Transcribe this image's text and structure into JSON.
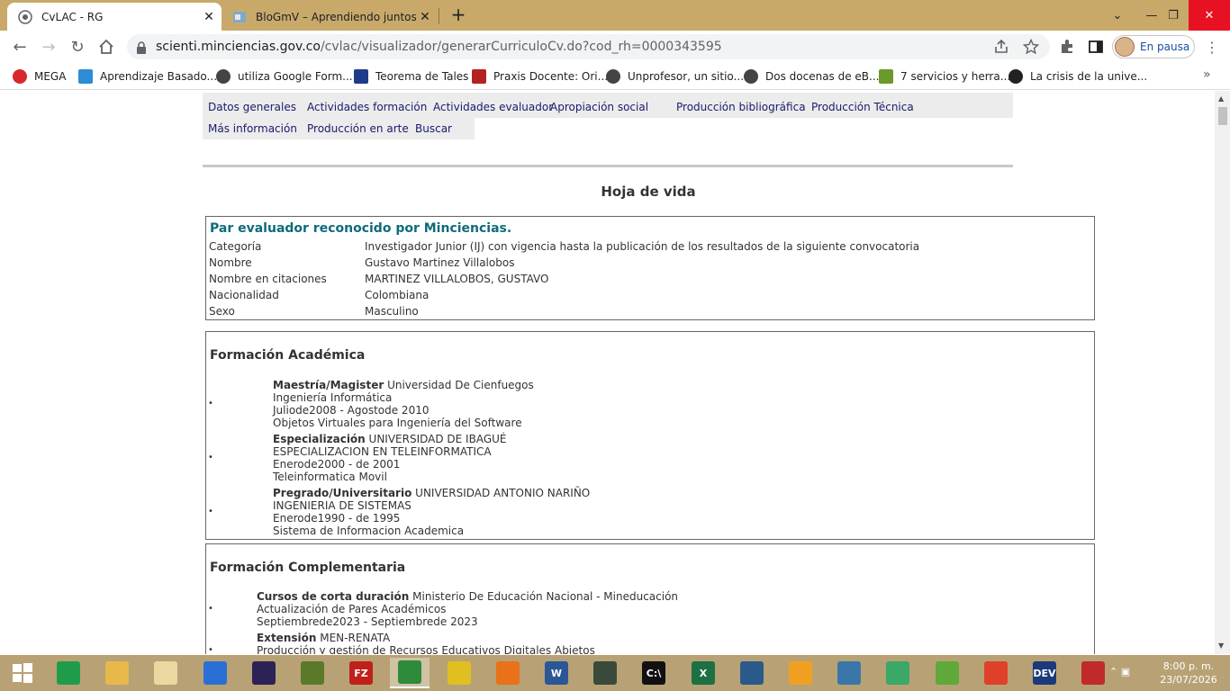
{
  "browser": {
    "tabs": [
      {
        "title": "CvLAC - RG",
        "active": true
      },
      {
        "title": "BloGmV – Aprendiendo juntos. B",
        "active": false
      }
    ],
    "url_host": "scienti.minciencias.gov.co",
    "url_path": "/cvlac/visualizador/generarCurriculoCv.do?cod_rh=0000343595",
    "profile_label": "En pausa",
    "bookmarks": [
      {
        "label": "MEGA",
        "color": "#d9272e"
      },
      {
        "label": "Aprendizaje Basado...",
        "color": "#2d8cd6"
      },
      {
        "label": "utiliza Google Form...",
        "color": "#444444"
      },
      {
        "label": "Teorema de Tales",
        "color": "#1f3a8a"
      },
      {
        "label": "Praxis Docente: Ori...",
        "color": "#b22222"
      },
      {
        "label": "Unprofesor, un sitio...",
        "color": "#444444"
      },
      {
        "label": "Dos docenas de eB...",
        "color": "#444444"
      },
      {
        "label": "7 servicios y herra...",
        "color": "#6a9a2a"
      },
      {
        "label": "La crisis de la unive...",
        "color": "#222222"
      }
    ]
  },
  "cv": {
    "nav": {
      "row1": [
        "Datos generales",
        "Actividades formación",
        "Actividades evaluador",
        "Apropiación social",
        "Producción bibliográfica",
        "Producción Técnica"
      ],
      "row2": [
        "Más información",
        "Producción en arte",
        "Buscar"
      ]
    },
    "title": "Hoja de vida",
    "general": {
      "header": "Par evaluador reconocido por Minciencias.",
      "rows": [
        {
          "label": "Categoría",
          "value": "Investigador Junior (IJ) con vigencia hasta la publicación de los resultados de la siguiente convocatoria"
        },
        {
          "label": "Nombre",
          "value": "Gustavo Martinez Villalobos"
        },
        {
          "label": "Nombre en citaciones",
          "value": "MARTINEZ VILLALOBOS, GUSTAVO"
        },
        {
          "label": "Nacionalidad",
          "value": "Colombiana"
        },
        {
          "label": "Sexo",
          "value": "Masculino"
        }
      ]
    },
    "academic": {
      "header": "Formación Académica",
      "entries": [
        {
          "level": "Maestría/Magister",
          "institution": "Universidad De Cienfuegos",
          "program": "Ingeniería Informática",
          "dates": "Juliode2008 - Agostode 2010",
          "thesis": "Objetos Virtuales para Ingeniería del Software"
        },
        {
          "level": "Especialización",
          "institution": "UNIVERSIDAD DE IBAGUÉ",
          "program": "ESPECIALIZACION EN TELEINFORMATICA",
          "dates": "Enerode2000 - de 2001",
          "thesis": "Teleinformatica Movil"
        },
        {
          "level": "Pregrado/Universitario",
          "institution": "UNIVERSIDAD ANTONIO NARIÑO",
          "program": "INGENIERIA DE SISTEMAS",
          "dates": "Enerode1990 - de 1995",
          "thesis": "Sistema de Informacion Academica"
        }
      ]
    },
    "complementary": {
      "header": "Formación Complementaria",
      "entries": [
        {
          "level": "Cursos de corta duración",
          "institution": "Ministerio De Educación Nacional - Mineducación",
          "program": "Actualización de Pares Académicos",
          "dates": "Septiembrede2023 - Septiembrede 2023"
        },
        {
          "level": "Extensión",
          "institution": "MEN-RENATA",
          "program": "Producción y gestión de Recursos Educativos Digitales Abietos"
        }
      ]
    }
  },
  "taskbar": {
    "time": "8:00 p. m.",
    "date": "23/07/2026",
    "apps": [
      {
        "name": "edge",
        "label": "",
        "color": "#1f9c4a"
      },
      {
        "name": "file-explorer",
        "label": "",
        "color": "#e8b84a"
      },
      {
        "name": "files",
        "label": "",
        "color": "#e9d9a0"
      },
      {
        "name": "pseint",
        "label": "",
        "color": "#2a6fd6"
      },
      {
        "name": "eclipse",
        "label": "",
        "color": "#2c2255"
      },
      {
        "name": "e-editor",
        "label": "",
        "color": "#5a7a2a"
      },
      {
        "name": "filezilla",
        "label": "FZ",
        "color": "#c0201a"
      },
      {
        "name": "chrome",
        "label": "",
        "color": "#2e8b3a"
      },
      {
        "name": "app-blocks",
        "label": "",
        "color": "#e0c020"
      },
      {
        "name": "firefox",
        "label": "",
        "color": "#e8711a"
      },
      {
        "name": "word",
        "label": "W",
        "color": "#2b5797"
      },
      {
        "name": "terminal-app",
        "label": "",
        "color": "#3a4a3a"
      },
      {
        "name": "cmd",
        "label": "C:\\",
        "color": "#111111"
      },
      {
        "name": "excel",
        "label": "X",
        "color": "#1d7044"
      },
      {
        "name": "virtualbox",
        "label": "",
        "color": "#2a5a8a"
      },
      {
        "name": "app-f",
        "label": "",
        "color": "#f0a020"
      },
      {
        "name": "python",
        "label": "",
        "color": "#3a76a8"
      },
      {
        "name": "atom",
        "label": "",
        "color": "#3aa866"
      },
      {
        "name": "cube-app",
        "label": "",
        "color": "#5fa83a"
      },
      {
        "name": "mosaic-app",
        "label": "",
        "color": "#e0402a"
      },
      {
        "name": "devcpp",
        "label": "DEV",
        "color": "#1a3a7a"
      },
      {
        "name": "paint-app",
        "label": "",
        "color": "#c02a2a"
      }
    ]
  }
}
